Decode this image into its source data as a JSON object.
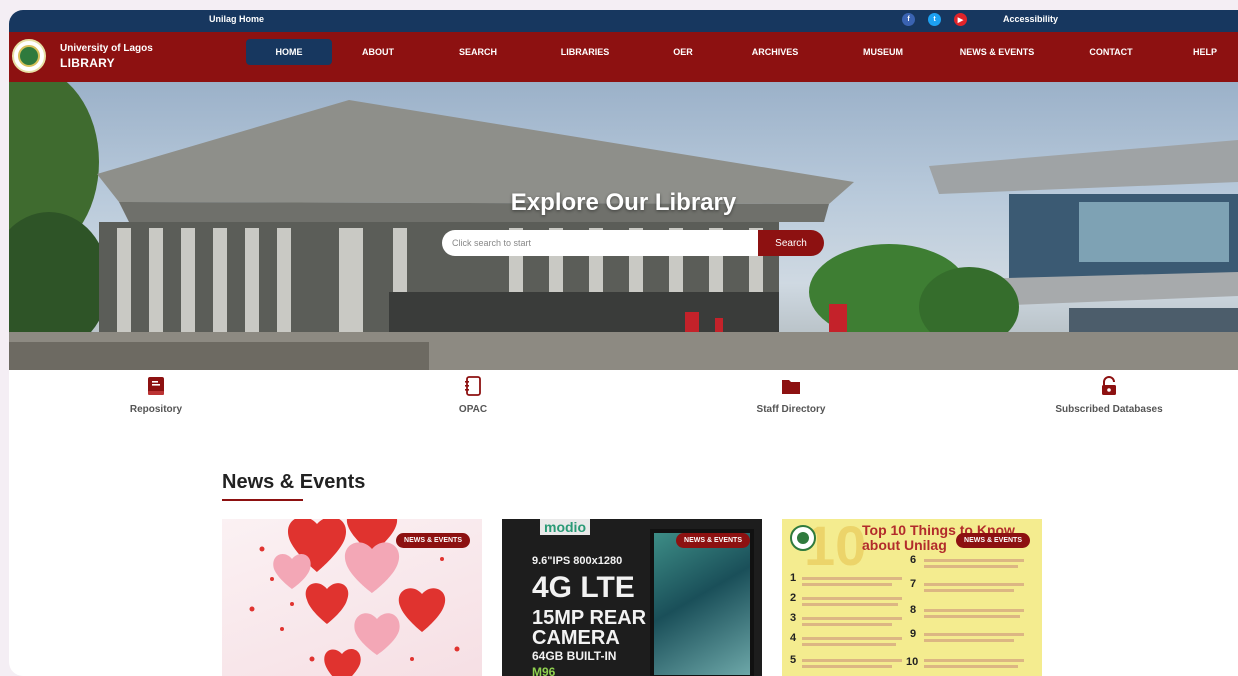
{
  "topbar": {
    "home_link": "Unilag Home",
    "accessibility": "Accessibility",
    "social": [
      "facebook-icon",
      "twitter-icon",
      "youtube-icon"
    ]
  },
  "brand": {
    "line1": "University of Lagos",
    "line2": "LIBRARY"
  },
  "nav": {
    "items": [
      "HOME",
      "ABOUT",
      "SEARCH",
      "LIBRARIES",
      "OER",
      "ARCHIVES",
      "MUSEUM",
      "NEWS & EVENTS",
      "CONTACT",
      "HELP"
    ],
    "active": "HOME"
  },
  "hero": {
    "title": "Explore Our Library",
    "search_placeholder": "Click search to start",
    "search_button": "Search"
  },
  "quick_links": [
    {
      "label": "Repository",
      "icon": "repository-book-icon"
    },
    {
      "label": "OPAC",
      "icon": "catalog-book-icon"
    },
    {
      "label": "Staff Directory",
      "icon": "folder-icon"
    },
    {
      "label": "Subscribed Databases",
      "icon": "unlock-icon"
    }
  ],
  "news": {
    "heading": "News & Events",
    "cards": [
      {
        "badge": "NEWS & EVENTS"
      },
      {
        "badge": "NEWS & EVENTS",
        "image_text": [
          "modio",
          "9.6\"IPS 800x1280",
          "4G LTE",
          "15MP REAR",
          "CAMERA",
          "64GB BUILT-IN",
          "M96"
        ]
      },
      {
        "badge": "NEWS & EVENTS",
        "image_text": [
          "10",
          "Top 10 Things to Know",
          "about Unilag"
        ]
      }
    ]
  },
  "colors": {
    "navy": "#17375f",
    "maroon": "#8d1111"
  }
}
